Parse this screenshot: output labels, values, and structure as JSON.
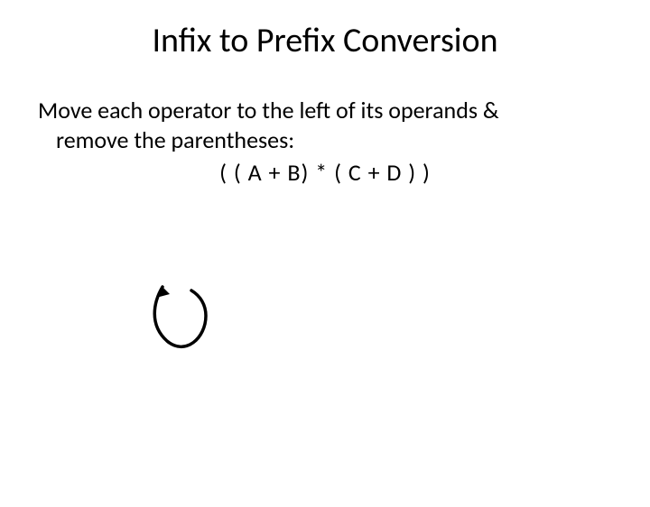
{
  "title": "Infix to Prefix Conversion",
  "instruction_line1": "Move each operator to the left of its operands &",
  "instruction_line2": "remove the parentheses:",
  "expression": "( ( A + B) * ( C + D ) )"
}
